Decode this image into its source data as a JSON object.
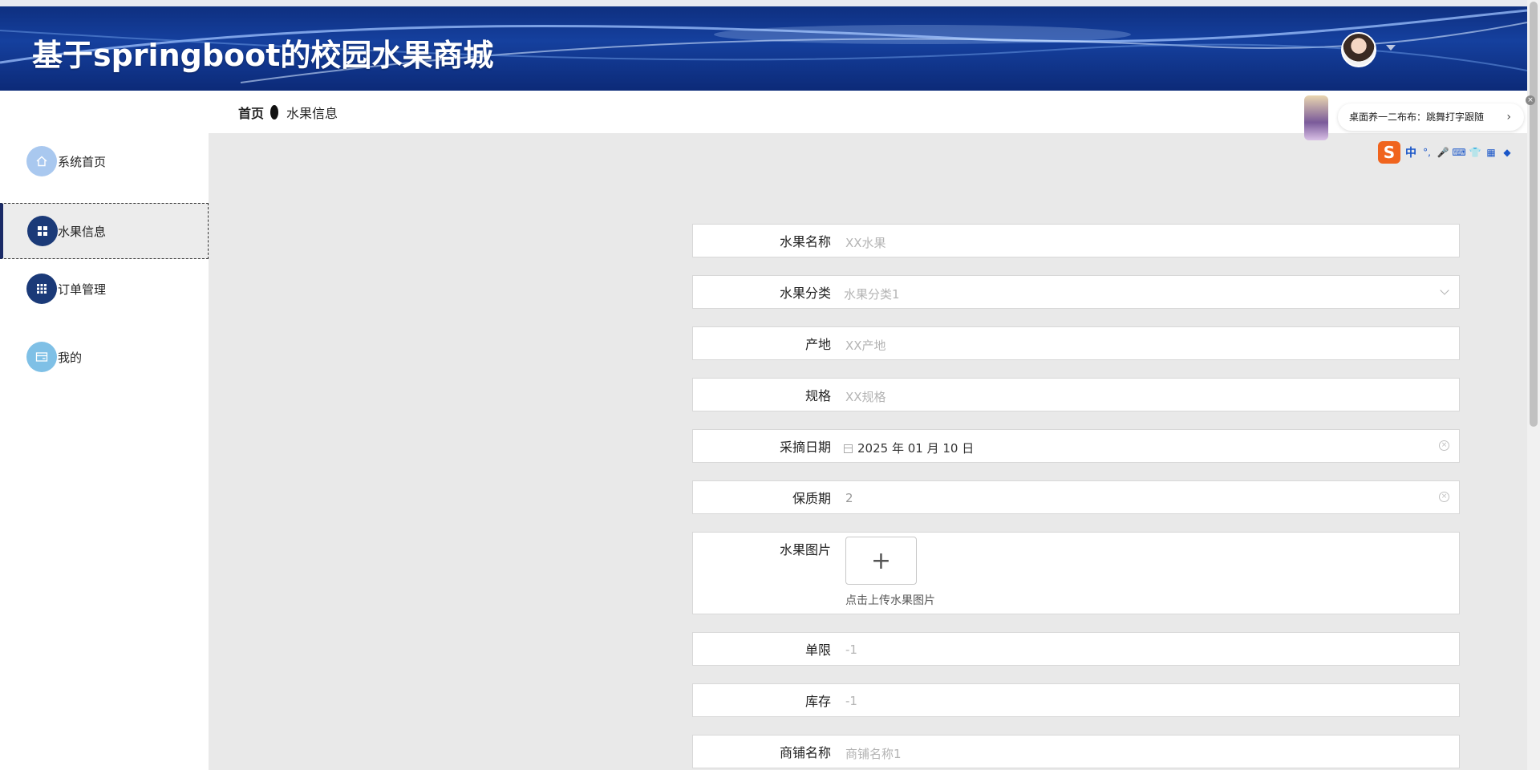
{
  "header": {
    "title": "基于springboot的校园水果商城",
    "avatar_icon": "user-avatar",
    "menu_icon": "caret-down-icon"
  },
  "sidebar": {
    "items": [
      {
        "label": "系统首页",
        "icon": "home-icon",
        "color": "#a9c8ef"
      },
      {
        "label": "水果信息",
        "icon": "grid-icon",
        "color": "#1b3a78"
      },
      {
        "label": "订单管理",
        "icon": "table-grid-icon",
        "color": "#1b3a78"
      },
      {
        "label": "我的",
        "icon": "card-icon",
        "color": "#7fc0e6"
      }
    ]
  },
  "breadcrumb": {
    "home": "首页",
    "current": "水果信息"
  },
  "form": {
    "name": {
      "label": "水果名称",
      "placeholder": "XX水果"
    },
    "category": {
      "label": "水果分类",
      "placeholder": "水果分类1"
    },
    "origin": {
      "label": "产地",
      "placeholder": "XX产地"
    },
    "spec": {
      "label": "规格",
      "placeholder": "XX规格"
    },
    "pick_date": {
      "label": "采摘日期",
      "value": "2025 年 01 月 10 日"
    },
    "shelf_life": {
      "label": "保质期",
      "value": "2"
    },
    "image": {
      "label": "水果图片",
      "upload_hint": "点击上传水果图片"
    },
    "limit": {
      "label": "单限",
      "placeholder": "-1"
    },
    "stock": {
      "label": "库存",
      "placeholder": "-1"
    },
    "shop": {
      "label": "商铺名称",
      "placeholder": "商铺名称1"
    }
  },
  "overlay": {
    "notification": "桌面养一二布布：跳舞打字跟随",
    "ime_mode": "中"
  }
}
